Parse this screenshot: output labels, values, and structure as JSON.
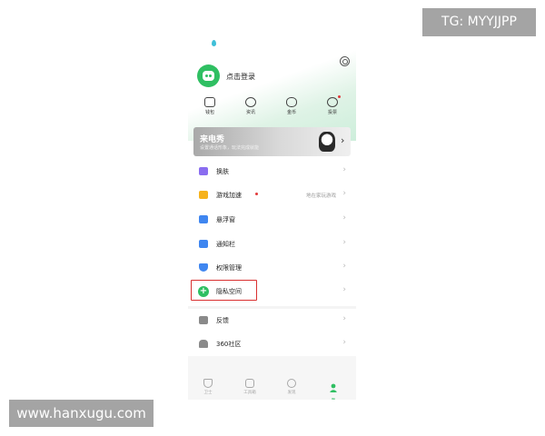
{
  "watermarks": {
    "top": "TG: MYYJJPP",
    "bottom": "www.hanxugu.com"
  },
  "header": {
    "login_text": "点击登录"
  },
  "quick_actions": [
    {
      "label": "钱包",
      "icon": "wallet-icon"
    },
    {
      "label": "资讯",
      "icon": "smile-icon"
    },
    {
      "label": "金币",
      "icon": "coins-icon"
    },
    {
      "label": "投票",
      "icon": "vote-icon"
    }
  ],
  "banner": {
    "title": "来电秀",
    "subtitle": "设置通话形象，玩法完成就能"
  },
  "menu": [
    {
      "label": "换肤",
      "icon": "tshirt-icon",
      "color": "#8a6df0"
    },
    {
      "label": "游戏加速",
      "icon": "gamepad-icon",
      "color": "#f6b21c",
      "hint": "地在家玩游戏",
      "dot": true
    },
    {
      "label": "悬浮窗",
      "icon": "float-window-icon",
      "color": "#3f86f0"
    },
    {
      "label": "通知栏",
      "icon": "notification-icon",
      "color": "#3f86f0"
    },
    {
      "label": "权限管理",
      "icon": "shield-icon",
      "color": "#3f86f0"
    },
    {
      "label": "隐私空间",
      "icon": "plus-circle-icon",
      "color": "#2fbf62"
    },
    {
      "label": "反馈",
      "icon": "feedback-icon",
      "color": "#8a8a8a"
    },
    {
      "label": "360社区",
      "icon": "home-icon",
      "color": "#8a8a8a"
    }
  ],
  "tabs": [
    {
      "label": "卫士",
      "icon": "shield-tab-icon"
    },
    {
      "label": "工具箱",
      "icon": "toolbox-tab-icon"
    },
    {
      "label": "发现",
      "icon": "compass-tab-icon"
    },
    {
      "label": "我",
      "icon": "person-tab-icon",
      "active": true
    }
  ],
  "colors": {
    "accent": "#2fbf62",
    "highlight_border": "#d93030",
    "badge": "#e23b3b"
  }
}
